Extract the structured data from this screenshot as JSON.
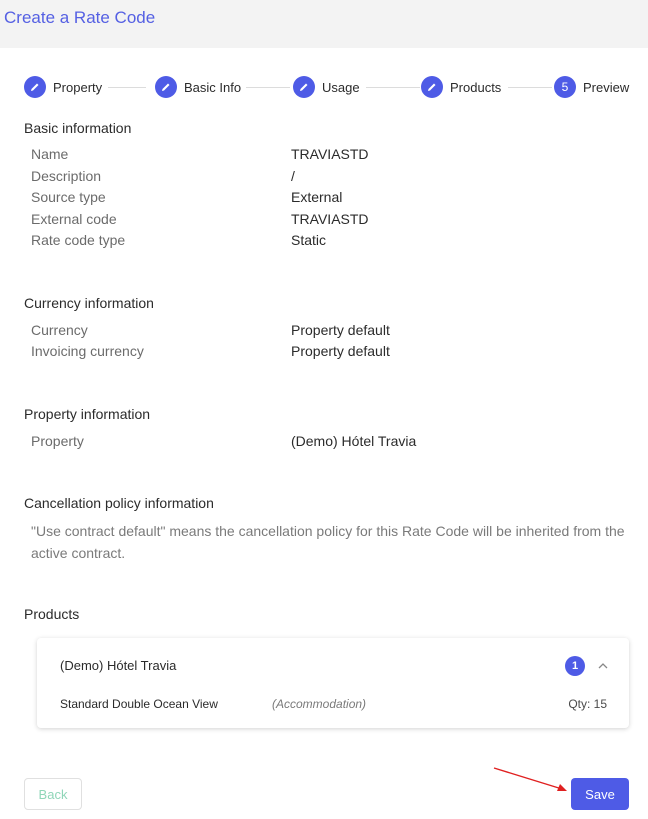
{
  "page": {
    "title": "Create a Rate Code"
  },
  "stepper": {
    "steps": [
      {
        "label": "Property",
        "marker": ""
      },
      {
        "label": "Basic Info",
        "marker": ""
      },
      {
        "label": "Usage",
        "marker": ""
      },
      {
        "label": "Products",
        "marker": ""
      },
      {
        "label": "Preview",
        "marker": "5"
      }
    ]
  },
  "basic": {
    "title": "Basic information",
    "rows": [
      {
        "key": "Name",
        "value": "TRAVIASTD"
      },
      {
        "key": "Description",
        "value": "/"
      },
      {
        "key": "Source type",
        "value": "External"
      },
      {
        "key": "External code",
        "value": "TRAVIASTD"
      },
      {
        "key": "Rate code type",
        "value": "Static"
      }
    ]
  },
  "currency": {
    "title": "Currency information",
    "rows": [
      {
        "key": "Currency",
        "value": "Property default"
      },
      {
        "key": "Invoicing currency",
        "value": "Property default"
      }
    ]
  },
  "property": {
    "title": "Property information",
    "rows": [
      {
        "key": "Property",
        "value": "(Demo) Hótel Travia"
      }
    ]
  },
  "cancellation": {
    "title": "Cancellation policy information",
    "note": "\"Use contract default\" means the cancellation policy for this Rate Code will be inherited from the active contract."
  },
  "products": {
    "title": "Products",
    "card": {
      "title": "(Demo) Hótel Travia",
      "badge": "1",
      "item": {
        "name": "Standard Double Ocean View",
        "type": "(Accommodation)",
        "qty": "Qty: 15"
      }
    }
  },
  "actions": {
    "back_label": "Back",
    "save_label": "Save"
  },
  "colors": {
    "accent": "#4e5be6",
    "title": "#5560e3",
    "back_text": "#8fd6b8",
    "annotation_arrow": "#e02020"
  }
}
